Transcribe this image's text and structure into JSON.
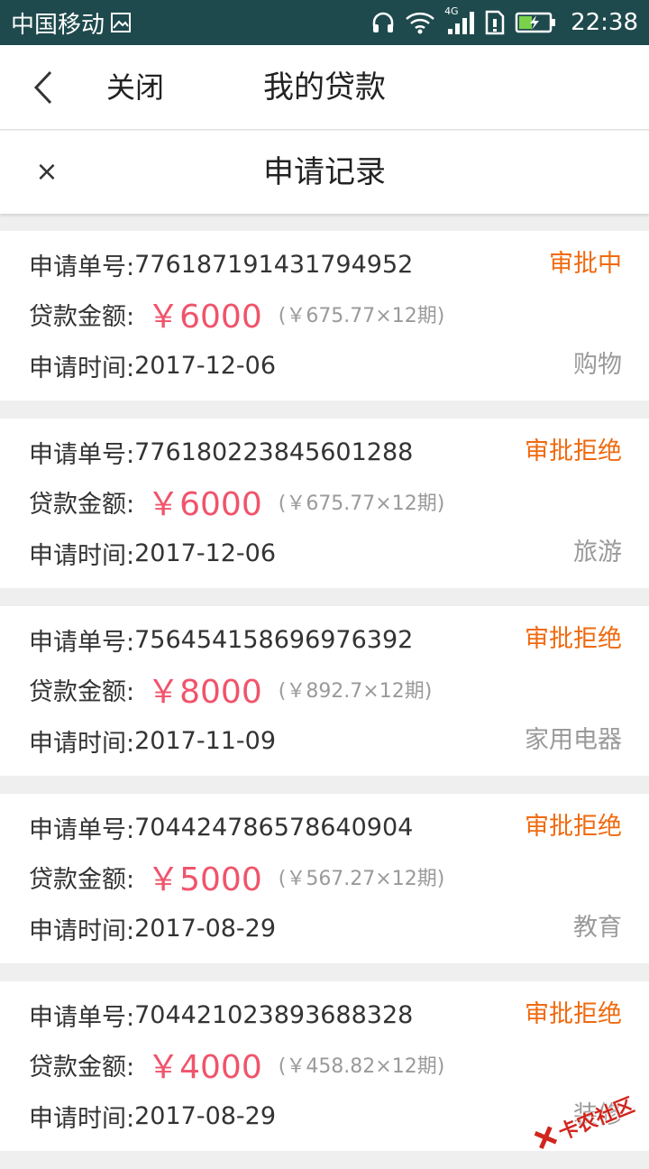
{
  "status_bar": {
    "carrier": "中国移动",
    "network": "4G",
    "time": "22:38"
  },
  "title_bar": {
    "close_label": "关闭",
    "title": "我的贷款"
  },
  "sub_header": {
    "close_glyph": "×",
    "title": "申请记录"
  },
  "labels": {
    "order_no": "申请单号:",
    "amount": "贷款金额:",
    "time": "申请时间:"
  },
  "records": [
    {
      "order_no": "776187191431794952",
      "status": "审批中",
      "amount": "￥6000",
      "installment": "(￥675.77×12期)",
      "date": "2017-12-06",
      "category": "购物"
    },
    {
      "order_no": "776180223845601288",
      "status": "审批拒绝",
      "amount": "￥6000",
      "installment": "(￥675.77×12期)",
      "date": "2017-12-06",
      "category": "旅游"
    },
    {
      "order_no": "756454158696976392",
      "status": "审批拒绝",
      "amount": "￥8000",
      "installment": "(￥892.7×12期)",
      "date": "2017-11-09",
      "category": "家用电器"
    },
    {
      "order_no": "704424786578640904",
      "status": "审批拒绝",
      "amount": "￥5000",
      "installment": "(￥567.27×12期)",
      "date": "2017-08-29",
      "category": "教育"
    },
    {
      "order_no": "704421023893688328",
      "status": "审批拒绝",
      "amount": "￥4000",
      "installment": "(￥458.82×12期)",
      "date": "2017-08-29",
      "category": "装修"
    }
  ],
  "watermark": {
    "text": "卡农社区"
  },
  "colors": {
    "status_bar_bg": "#1f4a4d",
    "status_text": "#f06a0f",
    "amount_text": "#f0546b",
    "muted_text": "#9a9a9a"
  }
}
